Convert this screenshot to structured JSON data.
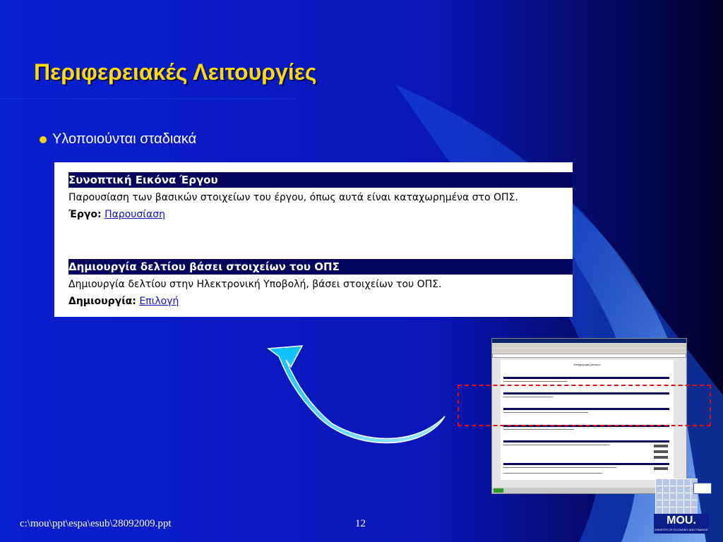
{
  "slide": {
    "title": "Περιφερειακές Λειτουργίες",
    "bullet": "Υλοποιούνται σταδιακά"
  },
  "panel": {
    "section1": {
      "header": "Συνοπτική Εικόνα Έργου",
      "description": "Παρουσίαση των βασικών στοιχείων του έργου, όπως αυτά είναι καταχωρημένα στο ΟΠΣ.",
      "label": "Έργο:",
      "link": "Παρουσίαση"
    },
    "section2": {
      "header": "Δημιουργία δελτίου βάσει στοιχείων του ΟΠΣ",
      "description": "Δημιουργία δελτίου στην Ηλεκτρονική Υποβολή, βάσει στοιχείων του ΟΠΣ.",
      "label": "Δημιουργία:",
      "link": "Επιλογή"
    }
  },
  "thumbnail": {
    "heading": "Καταχώρηση Δελτίων"
  },
  "logo": {
    "text": "MOU.",
    "subtext": "MINISTRY OF ECONOMY AND FINANCE"
  },
  "footer": {
    "path": "c:\\mou\\ppt\\espa\\esub\\28092009.ppt",
    "page_number": "12"
  },
  "colors": {
    "background": "#0a1fd0",
    "title": "#ffdc00",
    "section_header": "#06065e",
    "link": "#1010c0",
    "highlight_dash": "#e01010",
    "arrow": "#40d0f0"
  },
  "icons": {
    "arrow": "curved-arrow-icon",
    "bullet": "bullet-dot-icon"
  }
}
